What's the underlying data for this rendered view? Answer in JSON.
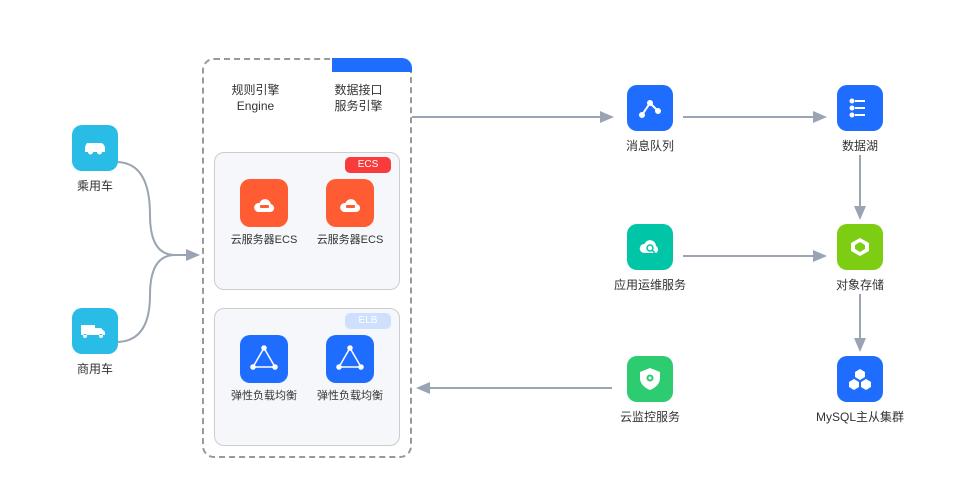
{
  "left": {
    "car": {
      "label": "乘用车"
    },
    "truck": {
      "label": "商用车"
    }
  },
  "mainbox": {
    "top_left_line1": "规则引擎",
    "top_left_line2": "Engine",
    "top_right_line1": "数据接口",
    "top_right_line2": "服务引擎",
    "ecs": {
      "tag": "ECS",
      "items": [
        {
          "label": "云服务器ECS"
        },
        {
          "label": "云服务器ECS"
        }
      ]
    },
    "elb": {
      "tag": "ELB",
      "items": [
        {
          "label": "弹性负载均衡"
        },
        {
          "label": "弹性负载均衡"
        }
      ]
    }
  },
  "right": {
    "msg_queue": {
      "label": "消息队列"
    },
    "data_store": {
      "label": "数据湖"
    },
    "aom": {
      "label": "应用运维服务"
    },
    "obs": {
      "label": "对象存储"
    },
    "ces": {
      "label": "云监控服务"
    },
    "mysql": {
      "label": "MySQL主从集群"
    }
  }
}
